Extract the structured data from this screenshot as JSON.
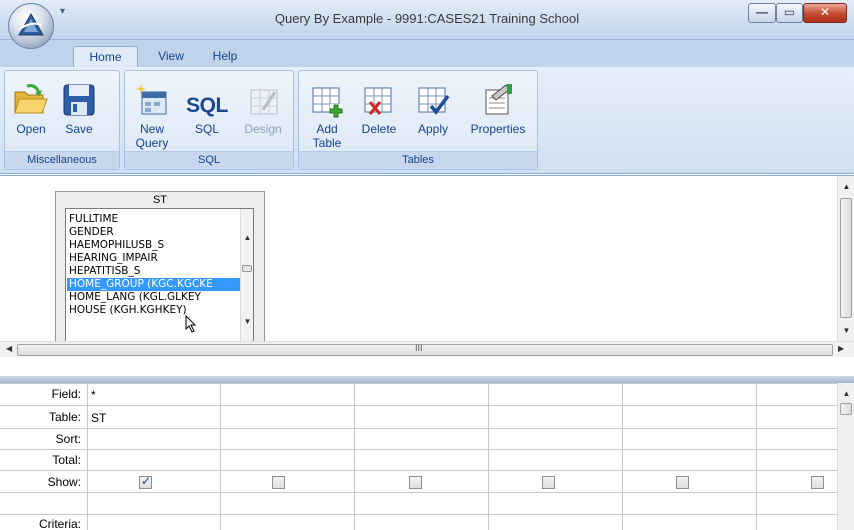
{
  "window": {
    "title": "Query By Example - 9991:CASES21 Training School",
    "qat_arrow": "▾",
    "min_glyph": "—",
    "max_glyph": "▭",
    "close_glyph": "✕"
  },
  "tabs": [
    {
      "label": "Home",
      "active": true
    },
    {
      "label": "View",
      "active": false
    },
    {
      "label": "Help",
      "active": false
    }
  ],
  "ribbon": {
    "groups": [
      {
        "label": "Miscellaneous",
        "buttons": [
          {
            "label": "Open",
            "icon": "folder-open-icon"
          },
          {
            "label": "Save",
            "icon": "floppy-disk-icon"
          }
        ]
      },
      {
        "label": "SQL",
        "buttons": [
          {
            "label": "New Query",
            "label_lines": [
              "New",
              "Query"
            ],
            "icon": "new-query-icon"
          },
          {
            "label": "SQL",
            "icon": "sql-text-icon",
            "icon_text": "SQL"
          },
          {
            "label": "Design",
            "icon": "design-grid-icon",
            "enabled": false
          }
        ]
      },
      {
        "label": "Tables",
        "buttons": [
          {
            "label": "Add Table",
            "label_lines": [
              "Add",
              "Table"
            ],
            "icon": "add-table-icon"
          },
          {
            "label": "Delete",
            "icon": "delete-table-icon"
          },
          {
            "label": "Apply",
            "icon": "apply-check-icon"
          },
          {
            "label": "Properties",
            "icon": "properties-icon"
          }
        ]
      }
    ]
  },
  "table_box": {
    "title": "ST",
    "fields": [
      "FULLTIME",
      "GENDER",
      "HAEMOPHILUSB_S",
      "HEARING_IMPAIR",
      "HEPATITISB_S",
      "HOME_GROUP (KGC.KGCKE",
      "HOME_LANG (KGL.GLKEY",
      "HOUSE (KGH.KGHKEY)"
    ],
    "selected_index": 5
  },
  "canvas": {
    "hscroll_thumb": "III"
  },
  "grid": {
    "row_labels": [
      "Field:",
      "Table:",
      "Sort:",
      "Total:",
      "Show:",
      "Criteria:"
    ],
    "columns": [
      {
        "field": "*",
        "table": "ST",
        "show": true
      },
      {
        "field": "",
        "table": "",
        "show": false
      },
      {
        "field": "",
        "table": "",
        "show": false
      },
      {
        "field": "",
        "table": "",
        "show": false
      },
      {
        "field": "",
        "table": "",
        "show": false
      },
      {
        "field": "",
        "table": "",
        "show": false
      }
    ]
  },
  "colors": {
    "ribbon_text": "#15428b",
    "selection": "#3399ff",
    "close_button": "#c44a2f"
  }
}
